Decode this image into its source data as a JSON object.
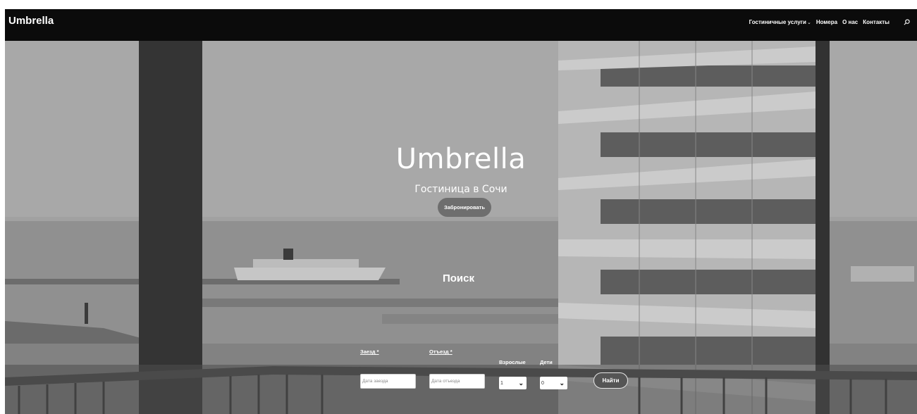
{
  "header": {
    "logo": "Umbrella",
    "nav": [
      {
        "label": "Гостиничные услуги",
        "has_dropdown": true
      },
      {
        "label": "Номера"
      },
      {
        "label": "О нас"
      },
      {
        "label": "Контакты"
      }
    ],
    "search_icon": "search-icon"
  },
  "hero": {
    "title": "Umbrella",
    "subtitle": "Гостиница в Сочи",
    "book_button": "Забронировать"
  },
  "search": {
    "title": "Поиск",
    "checkin_label": "Заезд",
    "checkin_required": "*",
    "checkin_placeholder": "Дата заезда",
    "checkout_label": "Отъезд",
    "checkout_required": "*",
    "checkout_placeholder": "Дата отъезда",
    "adults_label": "Взрослые",
    "adults_value": "1",
    "children_label": "Дети",
    "children_value": "0",
    "find_button": "Найти"
  },
  "colors": {
    "header_bg": "#0b0b0b",
    "button_bg": "#6e6e6e"
  }
}
